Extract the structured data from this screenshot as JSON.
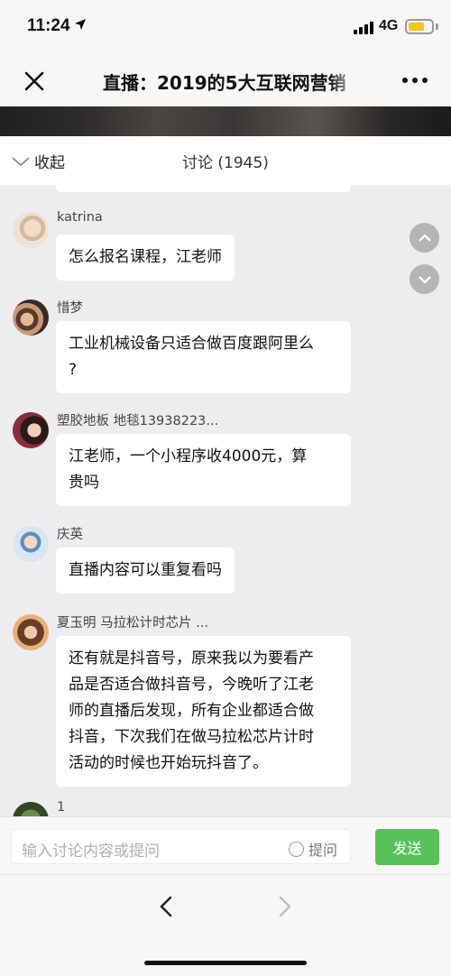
{
  "status_bar": {
    "time": "11:24",
    "network": "4G",
    "battery_level": 0.7
  },
  "nav": {
    "title": "直播：2019的5大互联网营销"
  },
  "discussion": {
    "collapse_label": "收起",
    "title": "讨论 (1945)"
  },
  "messages": [
    {
      "nick": "katrina",
      "lines": [
        "怎么报名课程，江老师"
      ]
    },
    {
      "nick": "惜梦",
      "lines": [
        "工业机械设备只适合做百度跟阿里么",
        "?"
      ]
    },
    {
      "nick": "塑胶地板 地毯13938223...",
      "lines": [
        "江老师，一个小程序收4000元，算",
        "贵吗"
      ]
    },
    {
      "nick": "庆英",
      "lines": [
        "直播内容可以重复看吗"
      ]
    },
    {
      "nick": "夏玉明 马拉松计时芯片 ...",
      "lines": [
        "还有就是抖音号，原来我以为要看产",
        "品是否适合做抖音号，今晚听了江老",
        "师的直播后发现，所有企业都适合做",
        "抖音，下次我们在做马拉松芯片计时",
        "活动的时候也开始玩抖音了。"
      ]
    },
    {
      "nick": "1",
      "lines": []
    }
  ],
  "input": {
    "placeholder": "输入讨论内容或提问",
    "ask_label": "提问",
    "send_label": "发送"
  },
  "colors": {
    "send_button": "#59c15a",
    "battery": "#f5c11b",
    "chat_background": "#ededf0"
  }
}
